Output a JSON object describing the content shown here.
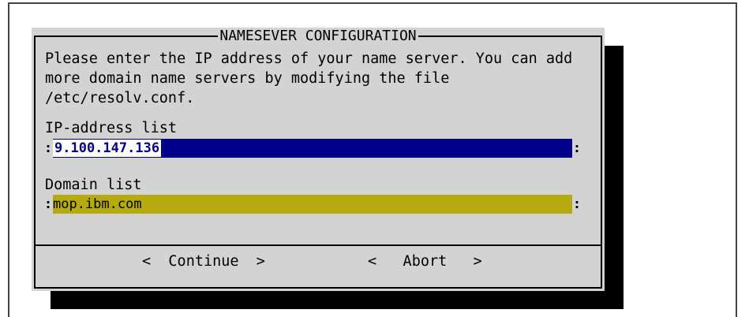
{
  "dialog": {
    "title": "NAMESEVER CONFIGURATION",
    "message": "Please enter the IP address of your name server. You can add\nmore domain name servers by modifying the file\n/etc/resolv.conf."
  },
  "fields": {
    "ip": {
      "label": "IP-address list",
      "value": "9.100.147.136",
      "colon_left": ":",
      "colon_right": ":"
    },
    "domain": {
      "label": "Domain list",
      "value": "mop.ibm.com",
      "colon_left": ":",
      "colon_right": ":"
    }
  },
  "buttons": {
    "continue_label": "<  Continue  >",
    "abort_label": "<   Abort   >"
  },
  "colors": {
    "dialog_bg": "#d3d3d3",
    "ip_field_bg": "#00008b",
    "domain_field_bg": "#b5aa0f",
    "shadow": "#000000"
  }
}
